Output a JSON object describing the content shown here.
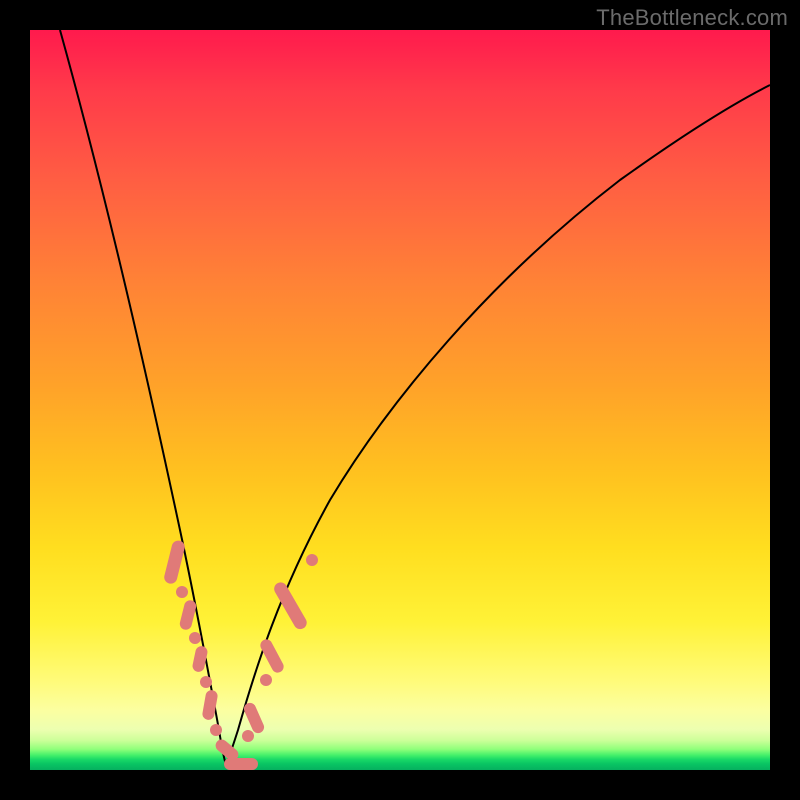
{
  "watermark": "TheBottleneck.com",
  "colors": {
    "background": "#000000",
    "gradient_top": "#ff1a4d",
    "gradient_mid1": "#ff8236",
    "gradient_mid2": "#ffde1f",
    "gradient_lowband": "#fbffa1",
    "gradient_bottom": "#06b05f",
    "curve": "#000000",
    "markers": "#e07a78"
  },
  "chart_data": {
    "type": "line",
    "title": "",
    "xlabel": "",
    "ylabel": "",
    "xlim": [
      0,
      100
    ],
    "ylim": [
      0,
      100
    ],
    "note": "No axis ticks or numeric labels are rendered. Values are estimated from pixel positions; y represents bottleneck percentage (0 at bottom / green, 100 at top / red).",
    "series": [
      {
        "name": "bottleneck-curve",
        "x": [
          4,
          6,
          8,
          10,
          12,
          14,
          16,
          18,
          20,
          21.5,
          23,
          24.5,
          25.5,
          26.5,
          28,
          30,
          33,
          37,
          42,
          48,
          55,
          63,
          72,
          82,
          92,
          100
        ],
        "y": [
          100,
          90,
          80,
          70,
          60,
          50,
          41,
          32,
          23,
          15,
          8,
          3,
          0.5,
          3,
          8,
          15,
          23,
          32,
          41,
          50,
          58,
          65,
          71,
          76,
          80,
          83
        ]
      }
    ],
    "markers": [
      {
        "x": 19.0,
        "y": 28,
        "shape": "pill-v",
        "len": 8
      },
      {
        "x": 19.7,
        "y": 22,
        "shape": "dot"
      },
      {
        "x": 20.4,
        "y": 18,
        "shape": "pill-v",
        "len": 6
      },
      {
        "x": 21.2,
        "y": 13,
        "shape": "dot"
      },
      {
        "x": 22.0,
        "y": 9,
        "shape": "pill-v",
        "len": 5
      },
      {
        "x": 23.0,
        "y": 5,
        "shape": "dot"
      },
      {
        "x": 24.0,
        "y": 2,
        "shape": "pill-h",
        "len": 5
      },
      {
        "x": 25.5,
        "y": 0.5,
        "shape": "pill-h",
        "len": 7
      },
      {
        "x": 27.2,
        "y": 2,
        "shape": "dot"
      },
      {
        "x": 28.6,
        "y": 6,
        "shape": "pill-d",
        "len": 6
      },
      {
        "x": 30.5,
        "y": 12,
        "shape": "dot"
      },
      {
        "x": 32.0,
        "y": 17,
        "shape": "pill-d",
        "len": 6
      },
      {
        "x": 34.0,
        "y": 23,
        "shape": "pill-d",
        "len": 9
      },
      {
        "x": 35.8,
        "y": 28,
        "shape": "dot"
      }
    ]
  }
}
